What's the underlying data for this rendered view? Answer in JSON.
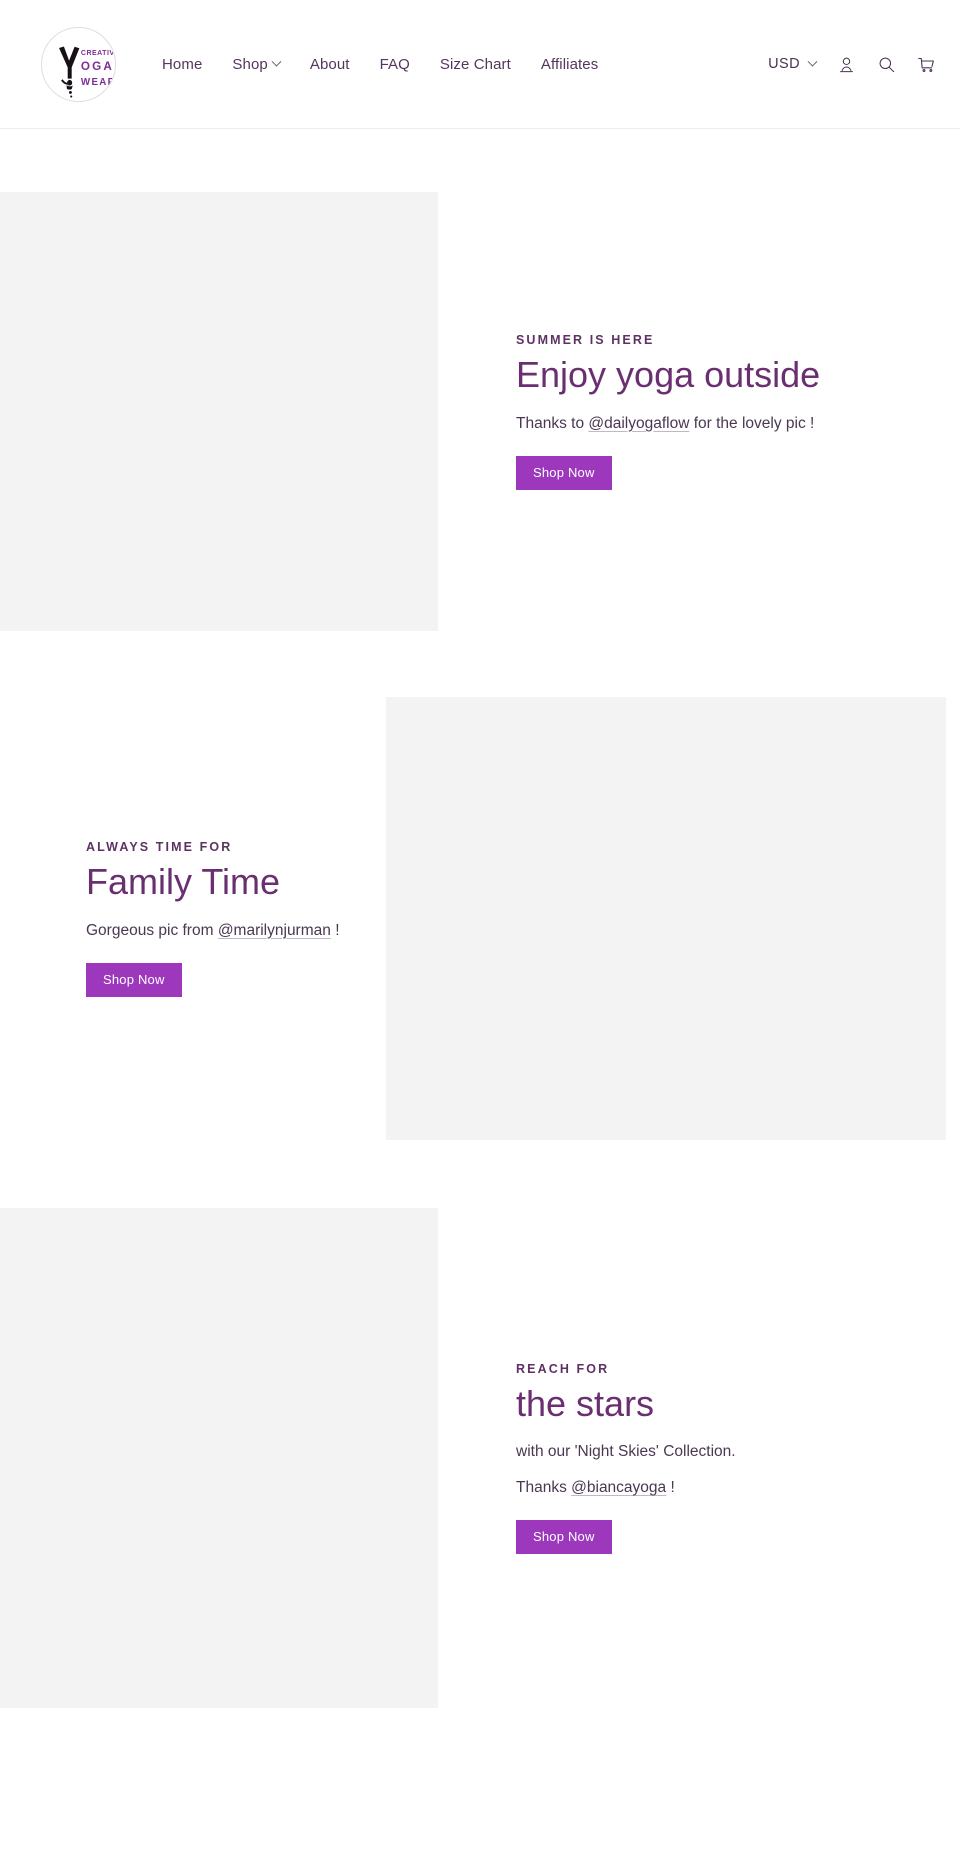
{
  "header": {
    "logo": {
      "name": "creative-yoga-wear-logo",
      "line1": "CREATIVE",
      "line2": "YOGA",
      "line3": "WEAR",
      "alt": "Creative Yoga Wear"
    },
    "nav": [
      {
        "label": "Home",
        "name": "nav-home",
        "has_caret": false
      },
      {
        "label": "Shop",
        "name": "nav-shop",
        "has_caret": true
      },
      {
        "label": "About",
        "name": "nav-about",
        "has_caret": false
      },
      {
        "label": "FAQ",
        "name": "nav-faq",
        "has_caret": false
      },
      {
        "label": "Size Chart",
        "name": "nav-size-chart",
        "has_caret": false
      },
      {
        "label": "Affiliates",
        "name": "nav-affiliates",
        "has_caret": false
      }
    ],
    "currency": {
      "value": "USD",
      "icon": "chevron-down-icon"
    },
    "icons": [
      {
        "name": "account-icon",
        "label": "Log in"
      },
      {
        "name": "search-icon",
        "label": "Search"
      },
      {
        "name": "cart-icon",
        "label": "Cart"
      }
    ]
  },
  "features": [
    {
      "id": "feature-1",
      "layout": "image-left",
      "eyebrow": "SUMMER IS HERE",
      "headline": "Enjoy yoga outside",
      "lines": [
        {
          "prefix": "Thanks to ",
          "handle": "@dailyogaflow",
          "suffix": " for the lovely pic !"
        }
      ],
      "cta": "Shop Now",
      "media_name": "feature-image-summer"
    },
    {
      "id": "feature-2",
      "layout": "image-right",
      "eyebrow": "ALWAYS TIME FOR",
      "headline": "Family Time",
      "lines": [
        {
          "prefix": "Gorgeous pic from ",
          "handle": "@marilynjurman",
          "suffix": " !"
        }
      ],
      "cta": "Shop Now",
      "media_name": "feature-image-family"
    },
    {
      "id": "feature-3",
      "layout": "image-left",
      "eyebrow": "REACH FOR",
      "headline": "the stars",
      "lines": [
        {
          "prefix": "with our 'Night Skies' Collection.",
          "handle": "",
          "suffix": ""
        },
        {
          "prefix": "Thanks ",
          "handle": "@biancayoga",
          "suffix": " !"
        }
      ],
      "cta": "Shop Now",
      "media_name": "feature-image-stars"
    }
  ],
  "colors": {
    "accent": "#9d38bd",
    "heading": "#6a2f70",
    "eyebrow": "#5d3263",
    "body_text": "#4a3752",
    "nav_text": "#54365c",
    "media_placeholder": "#f3f3f3",
    "header_border": "#ececec",
    "page_bg": "#ffffff"
  }
}
